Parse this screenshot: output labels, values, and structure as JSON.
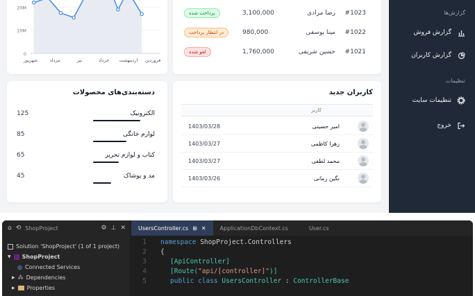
{
  "sidebar": {
    "section_reports": "گزارش‌ها",
    "item_sales_report": "گزارش فروش",
    "item_users_report": "گزارش کاربران",
    "section_settings": "تنظیمات",
    "item_site_settings": "تنظیمات سایت",
    "item_logout": "خروج"
  },
  "chart_data": {
    "type": "line",
    "categories": [
      "فروردین",
      "اردیبهشت",
      "خرداد",
      "تیر",
      "مرداد",
      "شهریور"
    ],
    "y_ticks": [
      "20M",
      "10M",
      "0"
    ],
    "ylim": [
      0,
      30
    ],
    "series": [
      {
        "x": [
          0.15,
          0.8,
          1.4,
          2.0,
          2.6,
          3.5,
          4.05,
          4.5,
          5.15
        ],
        "values": [
          22,
          24,
          17.5,
          15.5,
          26,
          32,
          19,
          27,
          17
        ]
      }
    ],
    "line_color": "#4a90e2",
    "fill_color": "#e8ecf2"
  },
  "orders": {
    "rows": [
      {
        "id": "#1023",
        "name": "رضا مرادی",
        "amount": "3,100,000",
        "status": "پرداخت شده",
        "status_type": "paid"
      },
      {
        "id": "#1022",
        "name": "مینا یوسفی",
        "amount": "980,000",
        "status": "در انتظار پرداخت",
        "status_type": "wait"
      },
      {
        "id": "#1021",
        "name": "حسین شریفی",
        "amount": "1,760,000",
        "status": "لغو شده",
        "status_type": "cancel"
      }
    ]
  },
  "categories": {
    "title": "دسته‌بندی‌های محصولات",
    "items": [
      {
        "name": "الکترونیک",
        "count": "125",
        "level": 1.0
      },
      {
        "name": "لوازم خانگی",
        "count": "85",
        "level": 0.7
      },
      {
        "name": "کتاب و لوازم تحریر",
        "count": "65",
        "level": 0.55
      },
      {
        "name": "مد و پوشاک",
        "count": "45",
        "level": 0.38
      }
    ]
  },
  "users": {
    "title": "کاربران جدید",
    "column_user": "کاربر",
    "rows": [
      {
        "name": "امیر حسینی",
        "date": "1403/03/28"
      },
      {
        "name": "زهرا کاظمی",
        "date": "1403/03/27"
      },
      {
        "name": "محمد لطفی",
        "date": "1403/03/27"
      },
      {
        "name": "نگین زمانی",
        "date": "1403/03/26"
      }
    ]
  },
  "ide": {
    "explorer_title": "ShopProject",
    "solution": "Solution 'ShopProject' (1 of 1 project)",
    "project": "ShopProject",
    "connected_services": "Connected Services",
    "dependencies": "Dependencies",
    "properties": "Properties",
    "tabs": [
      "UsersController.cs",
      "ApplicationDbContext.cs",
      "User.cs"
    ],
    "code": {
      "l1_kw": "namespace",
      "l1_rest": " ShopProject.Controllers",
      "l2": "{",
      "l3": "[ApiController]",
      "l4_a": "[Route(",
      "l4_s": "\"api/[controller]\"",
      "l4_b": ")]",
      "l5_kw": "public class",
      "l5_ty": "UsersController",
      "l5_rest": " : ",
      "l5_base": "ControllerBase"
    }
  }
}
